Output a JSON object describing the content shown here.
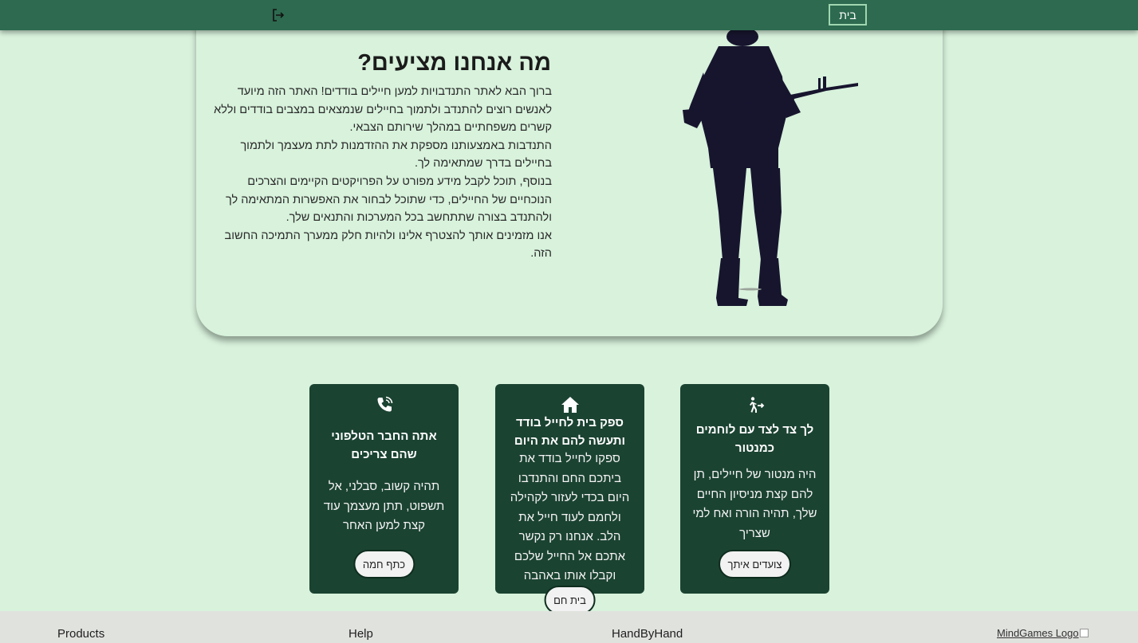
{
  "navbar": {
    "home_label": "בית",
    "logout_icon": "logout-icon"
  },
  "hero": {
    "title": "מה אנחנו מציעים?",
    "paragraphs": [
      "ברוך הבא לאתר התנדבויות למען חיילים בודדים! האתר הזה מיועד לאנשים רוצים להתנדב ולתמוך בחיילים שנמצאים במצבים בודדים וללא קשרים משפחתיים במהלך שירותם הצבאי.",
      "התנדבות באמצעותנו מספקת את ההזדמנות לתת מעצמך ולתמוך בחיילים בדרך שמתאימה לך.",
      "בנוסף, תוכל לקבל מידע מפורט על הפרויקטים הקיימים והצרכים הנוכחיים של החיילים, כדי שתוכל לבחור את האפשרות המתאימה לך ולהתנדב בצורה שתתחשב בכל המערכות והתנאים שלך.",
      "אנו מזמינים אותך להצטרף אלינו ולהיות חלק ממערך התמיכה החשוב הזה."
    ],
    "image_icon": "soldier-silhouette"
  },
  "cards": [
    {
      "icon": "walking-person-icon",
      "title": "לך צד לצד עם לוחמים כמנטור",
      "body": "היה מנטור של חיילים, תן להם קצת מניסיון החיים שלך, תהיה הורה ואח למי שצריך",
      "button": "צועדים איתך"
    },
    {
      "icon": "home-icon",
      "title": "ספק בית לחייל בודד ותעשה להם את היום",
      "body": "ספקו לחייל בודד את ביתכם החם והתנדבו היום בכדי לעזור לקהילה ולחמם לעוד חייל את הלב. אנחנו רק נקשר אתכם אל החייל שלכם וקבלו אותו באהבה",
      "button": "בית חם"
    },
    {
      "icon": "phone-call-icon",
      "title": "אתה החבר הטלפוני שהם צריכים",
      "body": "תהיה קשוב, סבלני, אל תשפוט, תתן מעצמך עוד קצת למען האחר",
      "button": "כתף חמה"
    }
  ],
  "footer": {
    "products": "Products",
    "help": "Help",
    "brand": "HandByHand",
    "logo_alt": "MindGames Logo"
  },
  "colors": {
    "navbar": "#2d6a4f",
    "card": "#1b4332",
    "background": "#d8f2dc",
    "footer": "#e0e2de"
  }
}
